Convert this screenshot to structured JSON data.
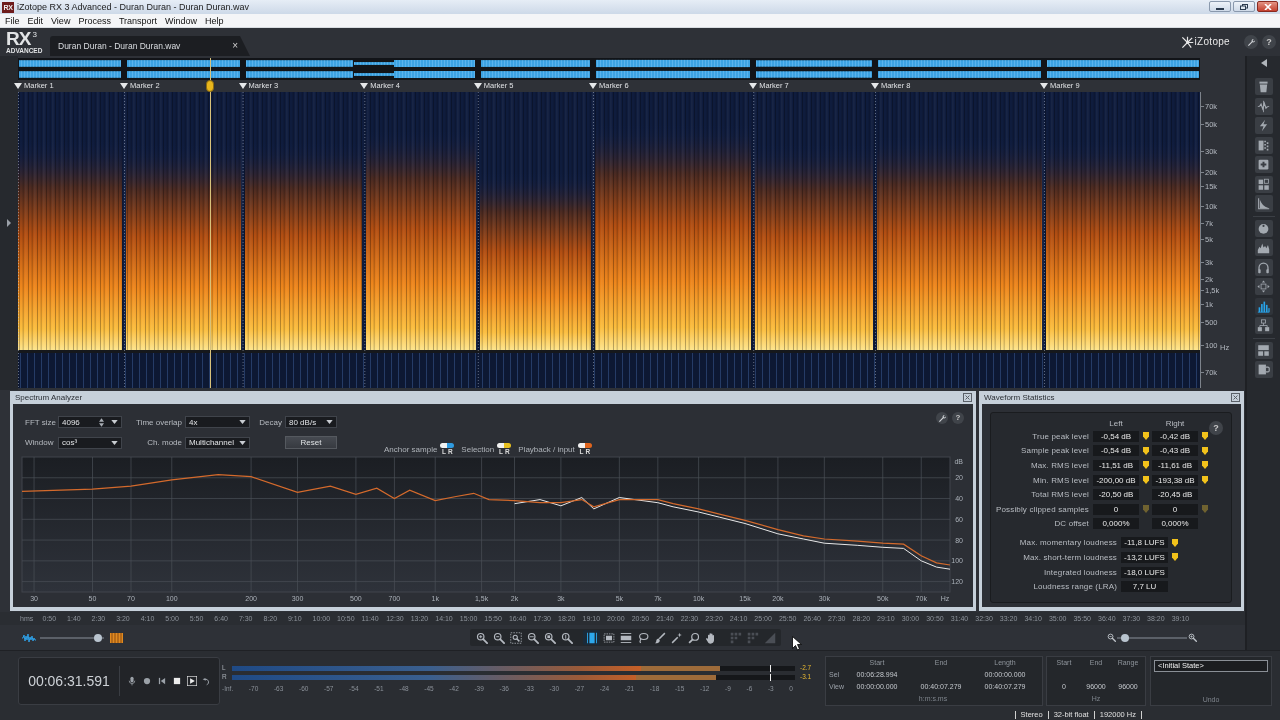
{
  "window": {
    "icon": "RX",
    "title": "iZotope RX 3 Advanced - Duran Duran - Duran Duran.wav"
  },
  "menu": [
    "File",
    "Edit",
    "View",
    "Process",
    "Transport",
    "Window",
    "Help"
  ],
  "logo": {
    "name": "RX",
    "version": "3",
    "edition": "ADVANCED"
  },
  "tabs": [
    {
      "label": "Duran Duran - Duran Duran.wav",
      "selected": true,
      "close": "×"
    }
  ],
  "brand": "iZotope",
  "help": "?",
  "markers": [
    "Marker 1",
    "Marker 2",
    "Marker 3",
    "Marker 4",
    "Marker 5",
    "Marker 6",
    "Marker 7",
    "Marker 8",
    "Marker 9"
  ],
  "spectrogram": {
    "unit": "Hz",
    "channels": [
      {
        "freq_labels": [
          "70k",
          "50k",
          "30k",
          "20k",
          "15k",
          "10k",
          "7k",
          "5k",
          "3k",
          "2k",
          "1,5k",
          "1k",
          "500",
          "100"
        ]
      },
      {
        "freq_labels": [
          "70k"
        ]
      }
    ]
  },
  "modules": [
    {
      "selected": false
    },
    {
      "selected": false
    },
    {
      "selected": false
    },
    {
      "selected": false
    },
    {
      "selected": false
    },
    {
      "selected": false
    },
    {
      "selected": false
    },
    {
      "selected": false
    },
    {
      "selected": false
    },
    {
      "selected": false
    },
    {
      "selected": false
    },
    {
      "selected": true
    },
    {
      "selected": false
    },
    {
      "selected": false
    },
    {
      "selected": false
    }
  ],
  "spectrum_analyzer": {
    "title": "Spectrum Analyzer",
    "help": "?",
    "controls": [
      {
        "label": "FFT size",
        "value": "4096",
        "kind": "spinner"
      },
      {
        "label": "Time overlap",
        "value": "4x",
        "kind": "dropdown"
      },
      {
        "label": "Decay",
        "value": "80 dB/s",
        "kind": "dropdown"
      },
      {
        "label": "Window",
        "value": "cos³",
        "kind": "dropdown"
      },
      {
        "label": "Ch. mode",
        "value": "Multichannel",
        "kind": "dropdown"
      }
    ],
    "reset": "Reset",
    "legend": [
      {
        "label": "Anchor sample",
        "color": "#2f9be0",
        "channels": [
          "L",
          "R"
        ]
      },
      {
        "label": "Selection",
        "color": "#e8c020",
        "channels": [
          "L",
          "R"
        ]
      },
      {
        "label": "Playback / input",
        "color": "#e0651e",
        "channels": [
          "L",
          "R"
        ]
      }
    ],
    "chart_data": [
      {
        "type": "line",
        "xlabel": "Hz",
        "ylabel": "dB",
        "log": "x",
        "grid": true,
        "xlim": [
          27,
          90000
        ],
        "ylim": [
          -130,
          0
        ],
        "xticks": [
          30,
          50,
          70,
          100,
          200,
          300,
          500,
          700,
          {
            "value": 1000,
            "label": "1k"
          },
          {
            "value": 1500,
            "label": "1,5k"
          },
          {
            "value": 2000,
            "label": "2k"
          },
          {
            "value": 3000,
            "label": "3k"
          },
          {
            "value": 5000,
            "label": "5k"
          },
          {
            "value": 7000,
            "label": "7k"
          },
          {
            "value": 10000,
            "label": "10k"
          },
          {
            "value": 15000,
            "label": "15k"
          },
          {
            "value": 20000,
            "label": "20k"
          },
          {
            "value": 30000,
            "label": "30k"
          },
          {
            "value": 50000,
            "label": "50k"
          },
          {
            "value": 70000,
            "label": "70k"
          }
        ],
        "yticks": [
          {
            "value": -20,
            "label": "20"
          },
          {
            "value": -40,
            "label": "40"
          },
          {
            "value": -60,
            "label": "60"
          },
          {
            "value": -80,
            "label": "80"
          },
          {
            "value": -100,
            "label": "100"
          },
          {
            "value": -120,
            "label": "120"
          }
        ],
        "x": [
          27,
          50,
          70,
          100,
          150,
          200,
          300,
          400,
          500,
          600,
          700,
          800,
          1000,
          1200,
          1400,
          1600,
          2000,
          2500,
          3000,
          3600,
          4000,
          5000,
          7000,
          8000,
          10000,
          12000,
          15000,
          20000,
          25000,
          30000,
          40000,
          50000,
          60000,
          70000,
          80000,
          90000
        ],
        "series": [
          {
            "color": "#e8e8e8",
            "values": [
              null,
              null,
              null,
              null,
              null,
              null,
              null,
              null,
              null,
              null,
              null,
              null,
              null,
              null,
              null,
              null,
              -45,
              -41,
              -47,
              -39,
              -50,
              -39,
              -44,
              -48,
              -53,
              -58,
              -64,
              -74,
              -79,
              -83,
              -85,
              -87,
              -88,
              -100,
              -106,
              -108
            ]
          },
          {
            "color": "#d46a2c",
            "values": [
              -33,
              -31,
              -28,
              -22,
              -17,
              -19,
              -34,
              -28,
              -36,
              -30,
              -40,
              -32,
              -42,
              -38,
              -35,
              -41,
              -42,
              -44,
              -44,
              -41,
              -48,
              -41,
              -41,
              -45,
              -50,
              -55,
              -61,
              -70,
              -76,
              -79,
              -81,
              -83,
              -84,
              -95,
              -102,
              -104
            ]
          }
        ]
      }
    ]
  },
  "waveform_statistics": {
    "title": "Waveform Statistics",
    "help": "?",
    "columns": [
      "Left",
      "Right"
    ],
    "rows": [
      {
        "label": "True peak level",
        "cells": [
          {
            "value": "-0,54 dB",
            "flag": {
              "enabled": true
            }
          },
          {
            "value": "-0,42 dB",
            "flag": {
              "enabled": true
            }
          }
        ]
      },
      {
        "label": "Sample peak level",
        "cells": [
          {
            "value": "-0,54 dB",
            "flag": {
              "enabled": true
            }
          },
          {
            "value": "-0,43 dB",
            "flag": {
              "enabled": true
            }
          }
        ]
      },
      {
        "label": "Max. RMS level",
        "cells": [
          {
            "value": "-11,51 dB",
            "flag": {
              "enabled": true
            }
          },
          {
            "value": "-11,61 dB",
            "flag": {
              "enabled": true
            }
          }
        ]
      },
      {
        "label": "Min. RMS level",
        "cells": [
          {
            "value": "-200,00 dB",
            "flag": {
              "enabled": true
            }
          },
          {
            "value": "-193,38 dB",
            "flag": {
              "enabled": true
            }
          }
        ]
      },
      {
        "label": "Total RMS level",
        "cells": [
          {
            "value": "-20,50 dB"
          },
          {
            "value": "-20,45 dB"
          }
        ]
      },
      {
        "label": "Possibly clipped samples",
        "cells": [
          {
            "value": "0",
            "flag": {
              "enabled": false
            }
          },
          {
            "value": "0",
            "flag": {
              "enabled": false
            }
          }
        ]
      },
      {
        "label": "DC offset",
        "cells": [
          {
            "value": "0,000%"
          },
          {
            "value": "0,000%"
          }
        ]
      }
    ],
    "loudness": [
      {
        "label": "Max. momentary loudness",
        "value": "-11,8 LUFS",
        "flag": {
          "enabled": true
        }
      },
      {
        "label": "Max. short-term loudness",
        "value": "-13,2 LUFS",
        "flag": {
          "enabled": true
        }
      },
      {
        "label": "Integrated loudness",
        "value": "-18,0 LUFS"
      },
      {
        "label": "Loudness range (LRA)",
        "value": "7,7 LU"
      }
    ]
  },
  "time_ruler": {
    "unit": "hms",
    "labels": [
      "0:50",
      "1:40",
      "2:30",
      "3:20",
      "4:10",
      "5:00",
      "5:50",
      "6:40",
      "7:30",
      "8:20",
      "9:10",
      "10:00",
      "10:50",
      "11:40",
      "12:30",
      "13:20",
      "14:10",
      "15:00",
      "15:50",
      "16:40",
      "17:30",
      "18:20",
      "19:10",
      "20:00",
      "20:50",
      "21:40",
      "22:30",
      "23:20",
      "24:10",
      "25:00",
      "25:50",
      "26:40",
      "27:30",
      "28:20",
      "29:10",
      "30:00",
      "30:50",
      "31:40",
      "32:30",
      "33:20",
      "34:10",
      "35:00",
      "35:50",
      "36:40",
      "37:30",
      "38:20",
      "39:10"
    ]
  },
  "view_slider": {
    "level": 0.96
  },
  "tools": [
    {
      "selected": false,
      "disabled": false
    },
    {
      "selected": false,
      "disabled": false
    },
    {
      "selected": false,
      "disabled": false
    },
    {
      "selected": false,
      "disabled": false
    },
    {
      "selected": false,
      "disabled": false
    },
    {
      "selected": false,
      "disabled": false
    },
    {
      "selected": true,
      "disabled": false
    },
    {
      "selected": false,
      "disabled": false
    },
    {
      "selected": false,
      "disabled": false
    },
    {
      "selected": false,
      "disabled": false
    },
    {
      "selected": false,
      "disabled": false
    },
    {
      "selected": false,
      "disabled": false
    },
    {
      "selected": false,
      "disabled": false
    },
    {
      "selected": false,
      "disabled": false
    },
    {
      "selected": false,
      "disabled": true
    },
    {
      "selected": false,
      "disabled": true
    },
    {
      "selected": false,
      "disabled": true
    }
  ],
  "zoom_slider": {
    "level": 0.06
  },
  "transport": {
    "time": "00:06:31.591"
  },
  "meter": {
    "channels": [
      {
        "label": "L",
        "rms": {
          "level": 0.727
        },
        "peak": {
          "level": 0.866
        },
        "hold": {
          "level": 0.955
        },
        "reading": "-2.7"
      },
      {
        "label": "R",
        "rms": {
          "level": 0.718
        },
        "peak": {
          "level": 0.86
        },
        "hold": {
          "level": 0.955
        },
        "reading": "-3.1"
      }
    ],
    "scale": [
      "-Inf.",
      "-70",
      "-63",
      "-60",
      "-57",
      "-54",
      "-51",
      "-48",
      "-45",
      "-42",
      "-39",
      "-36",
      "-33",
      "-30",
      "-27",
      "-24",
      "-21",
      "-18",
      "-15",
      "-12",
      "-9",
      "-6",
      "-3",
      "0"
    ]
  },
  "selection": {
    "columns": [
      "Start",
      "End",
      "Length"
    ],
    "rows": [
      {
        "label": "Sel",
        "start": "00:06:28.994",
        "length": "00:00:00.000"
      },
      {
        "label": "View",
        "start": "00:00:00.000",
        "end": "00:40:07.279",
        "length": "00:40:07.279"
      }
    ],
    "unit": "h:m:s.ms"
  },
  "frequency": {
    "columns": [
      "Start",
      "End",
      "Range"
    ],
    "view": {
      "start": "0",
      "end": "96000",
      "range": "96000"
    },
    "unit": "Hz"
  },
  "undo": {
    "items": [
      {
        "label": "<Initial State>",
        "selected": true
      }
    ],
    "title": "Undo"
  },
  "status_bar": [
    "Stereo",
    "32-bit float",
    "192000 Hz"
  ]
}
